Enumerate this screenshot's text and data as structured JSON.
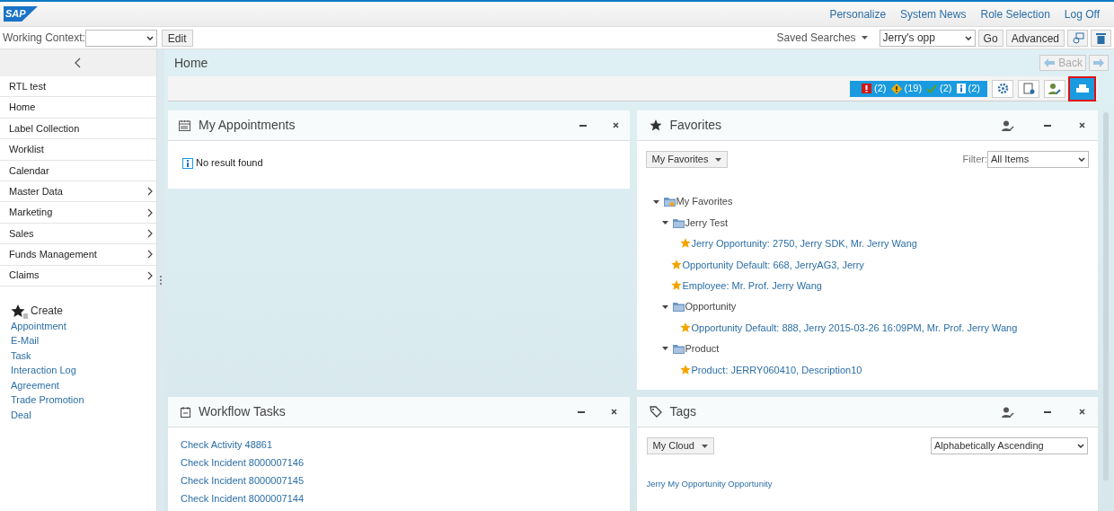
{
  "header": {
    "logo": "SAP",
    "links": [
      "Personalize",
      "System News",
      "Role Selection",
      "Log Off"
    ]
  },
  "context_bar": {
    "working_context_label": "Working Context:",
    "edit_button": "Edit",
    "saved_searches": "Saved Searches",
    "saved_search_value": "Jerry's opp",
    "go_button": "Go",
    "advanced_button": "Advanced"
  },
  "sidebar": {
    "items": [
      {
        "label": "RTL test",
        "has_submenu": false
      },
      {
        "label": "Home",
        "has_submenu": false
      },
      {
        "label": "Label Collection",
        "has_submenu": false
      },
      {
        "label": "Worklist",
        "has_submenu": false
      },
      {
        "label": "Calendar",
        "has_submenu": false
      },
      {
        "label": "Master Data",
        "has_submenu": true
      },
      {
        "label": "Marketing",
        "has_submenu": true
      },
      {
        "label": "Sales",
        "has_submenu": true
      },
      {
        "label": "Funds Management",
        "has_submenu": true
      },
      {
        "label": "Claims",
        "has_submenu": true
      }
    ],
    "create": {
      "title": "Create",
      "links": [
        "Appointment",
        "E-Mail",
        "Task",
        "Interaction Log",
        "Agreement",
        "Trade Promotion",
        "Deal"
      ]
    }
  },
  "page": {
    "title": "Home",
    "back_button": "Back",
    "messages": [
      {
        "kind": "error",
        "count": "(2)"
      },
      {
        "kind": "warning",
        "count": "(19)"
      },
      {
        "kind": "success",
        "count": "(2)"
      },
      {
        "kind": "info",
        "count": "(2)"
      }
    ]
  },
  "appointments": {
    "title": "My Appointments",
    "message": "No result found"
  },
  "favorites": {
    "title": "Favorites",
    "menu_button": "My Favorites",
    "filter_label": "Filter:",
    "filter_value": "All Items",
    "tree": [
      {
        "kind": "root",
        "label": "My Favorites",
        "expanded": true,
        "children": [
          {
            "kind": "folder",
            "label": "Jerry Test",
            "expanded": true,
            "children": [
              {
                "kind": "item",
                "label": "Jerry Opportunity: 2750, Jerry SDK, Mr. Jerry Wang"
              }
            ]
          },
          {
            "kind": "item",
            "label": "Opportunity Default: 668, JerryAG3, Jerry"
          },
          {
            "kind": "item",
            "label": "Employee: Mr. Prof. Jerry Wang"
          },
          {
            "kind": "folder",
            "label": "Opportunity",
            "expanded": true,
            "children": [
              {
                "kind": "item",
                "label": "Opportunity Default: 888, Jerry 2015-03-26 16:09PM, Mr. Prof. Jerry Wang"
              }
            ]
          },
          {
            "kind": "folder",
            "label": "Product",
            "expanded": true,
            "children": [
              {
                "kind": "item",
                "label": "Product: JERRY060410, Description10"
              }
            ]
          }
        ]
      }
    ]
  },
  "workflow": {
    "title": "Workflow Tasks",
    "tasks": [
      "Check Activity 48861",
      "Check Incident 8000007146",
      "Check Incident 8000007145",
      "Check Incident 8000007144"
    ]
  },
  "tags": {
    "title": "Tags",
    "menu_button": "My Cloud",
    "sort_value": "Alphabetically Ascending",
    "tags": [
      "Jerry My Opportunity Opportunity"
    ]
  }
}
